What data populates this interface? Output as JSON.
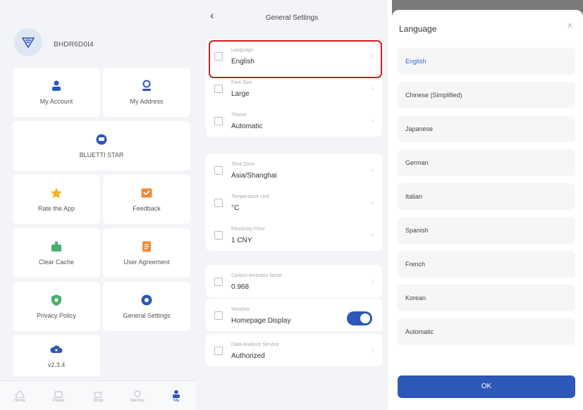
{
  "profile": {
    "user_id": "BHDR6D0I4"
  },
  "me_menu": [
    {
      "label": "My Account",
      "icon": "person-icon",
      "color": "#2d57b8"
    },
    {
      "label": "My Address",
      "icon": "location-pin-icon",
      "color": "#2d57b8"
    },
    {
      "label": "BLUETTI STAR",
      "icon": "star-badge-icon",
      "color": "#2d57b8"
    },
    {
      "label": "Rate the App",
      "icon": "rate-star-icon",
      "color": "#f2b51d"
    },
    {
      "label": "Feedback",
      "icon": "feedback-icon",
      "color": "#f08b3a"
    },
    {
      "label": "Clear Cache",
      "icon": "broom-icon",
      "color": "#4cae6e"
    },
    {
      "label": "User Agreement",
      "icon": "document-icon",
      "color": "#f08b3a"
    },
    {
      "label": "Privacy Policy",
      "icon": "shield-icon",
      "color": "#4cae6e"
    },
    {
      "label": "General Settings",
      "icon": "gear-icon",
      "color": "#2d57b8"
    },
    {
      "label": "v2.3.4",
      "icon": "cloud-info-icon",
      "color": "#2d57b8"
    }
  ],
  "tabbar": [
    {
      "label": "Home",
      "icon": "home-icon"
    },
    {
      "label": "Power",
      "icon": "power-icon"
    },
    {
      "label": "Shop",
      "icon": "shop-icon"
    },
    {
      "label": "Service",
      "icon": "service-icon"
    },
    {
      "label": "Me",
      "icon": "me-icon",
      "active": true
    }
  ],
  "settings": {
    "title": "General Settings",
    "groups": [
      [
        {
          "label": "Language",
          "value": "English",
          "icon": "language-icon"
        },
        {
          "label": "Font Size",
          "value": "Large",
          "icon": "font-size-icon"
        },
        {
          "label": "Theme",
          "value": "Automatic",
          "icon": "theme-icon"
        }
      ],
      [
        {
          "label": "Time Zone",
          "value": "Asia/Shanghai",
          "icon": "clock-icon"
        },
        {
          "label": "Temperature Unit",
          "value": "°C",
          "icon": "thermometer-icon"
        },
        {
          "label": "Electricity Price",
          "value": "1 CNY",
          "icon": "price-icon"
        }
      ],
      [
        {
          "label": "Carbon emission factor",
          "value": "0.968",
          "icon": "carbon-icon"
        }
      ],
      [
        {
          "label": "Weather",
          "value": "Homepage Display",
          "icon": "weather-icon",
          "toggle": true
        }
      ],
      [
        {
          "label": "Data Analysis Service",
          "value": "Authorized",
          "icon": "data-icon"
        }
      ]
    ]
  },
  "language_sheet": {
    "title": "Language",
    "options": [
      "English",
      "Chinese (Simplified)",
      "Japanese",
      "German",
      "Italian",
      "Spanish",
      "French",
      "Korean",
      "Automatic"
    ],
    "selected": "English",
    "ok": "OK"
  },
  "colors": {
    "accent": "#2d57b8",
    "highlight": "#d11e1e"
  }
}
